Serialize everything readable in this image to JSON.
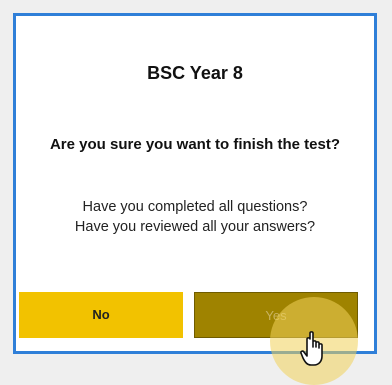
{
  "dialog": {
    "title": "BSC Year 8",
    "question": "Are you sure you want to finish the test?",
    "check_line_1": "Have you completed all questions?",
    "check_line_2": "Have you reviewed all your answers?",
    "no_label": "No",
    "yes_label": "Yes"
  },
  "colors": {
    "border": "#2f7fd8",
    "no_button": "#f2c200",
    "yes_button": "#9f8300"
  },
  "icons": {
    "cursor": "hand-pointer-icon"
  }
}
